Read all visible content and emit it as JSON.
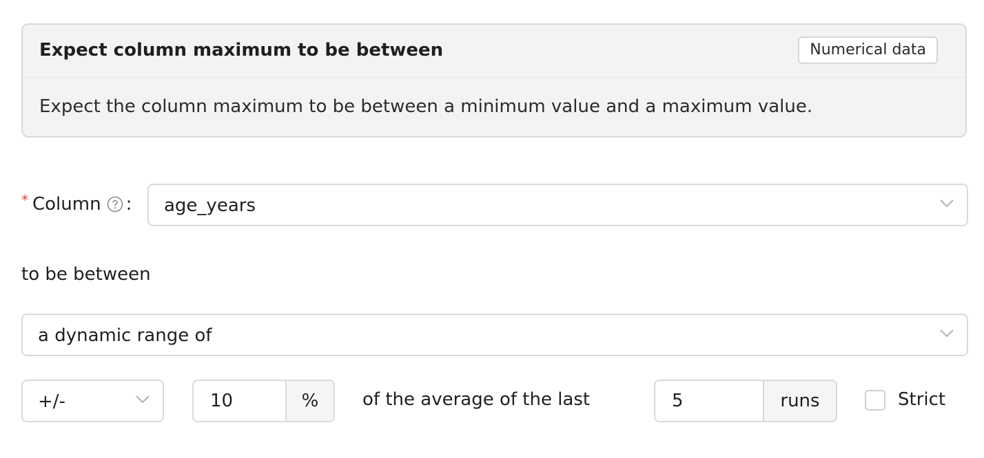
{
  "card": {
    "title": "Expect column maximum to be between",
    "badge": "Numerical data",
    "description": "Expect the column maximum to be between a minimum value and a maximum value."
  },
  "column_field": {
    "required_mark": "*",
    "label": "Column",
    "label_suffix": ":",
    "help_icon": "question-circle-icon",
    "value": "age_years"
  },
  "between_text": "to be between",
  "range_select": {
    "value": "a dynamic range of"
  },
  "tolerance": {
    "operator": "+/-",
    "amount": "10",
    "unit": "%"
  },
  "average_text": "of the average of the last",
  "runs": {
    "count": "5",
    "unit": "runs"
  },
  "strict": {
    "label": "Strict",
    "checked": false
  },
  "colors": {
    "required": "#e0483b",
    "border": "#d9d9dc",
    "card_background": "#f3f3f5"
  }
}
